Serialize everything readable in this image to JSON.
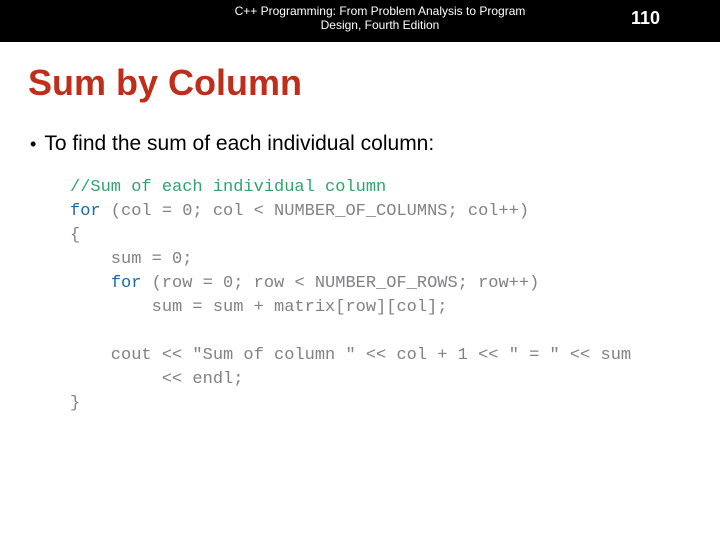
{
  "header": {
    "book_title_line1": "C++ Programming: From Problem Analysis to Program",
    "book_title_line2": "Design, Fourth Edition",
    "page_number": "110"
  },
  "title": "Sum by Column",
  "bullet": "To find the sum of each individual column:",
  "code": {
    "l1_comment": "//Sum of each individual column",
    "l2_kw": "for",
    "l2_rest": " (col = 0; col < NUMBER_OF_COLUMNS; col++)",
    "l3": "{",
    "l4": "    sum = 0;",
    "l5_pad": "    ",
    "l5_kw": "for",
    "l5_rest": " (row = 0; row < NUMBER_OF_ROWS; row++)",
    "l6": "        sum = sum + matrix[row][col];",
    "l7_pad": "    cout << ",
    "l7_str": "\"Sum of column \"",
    "l7_mid": " << col + 1 << ",
    "l7_str2": "\" = \"",
    "l7_end": " << sum",
    "l8": "         << endl;",
    "l9": "}"
  }
}
